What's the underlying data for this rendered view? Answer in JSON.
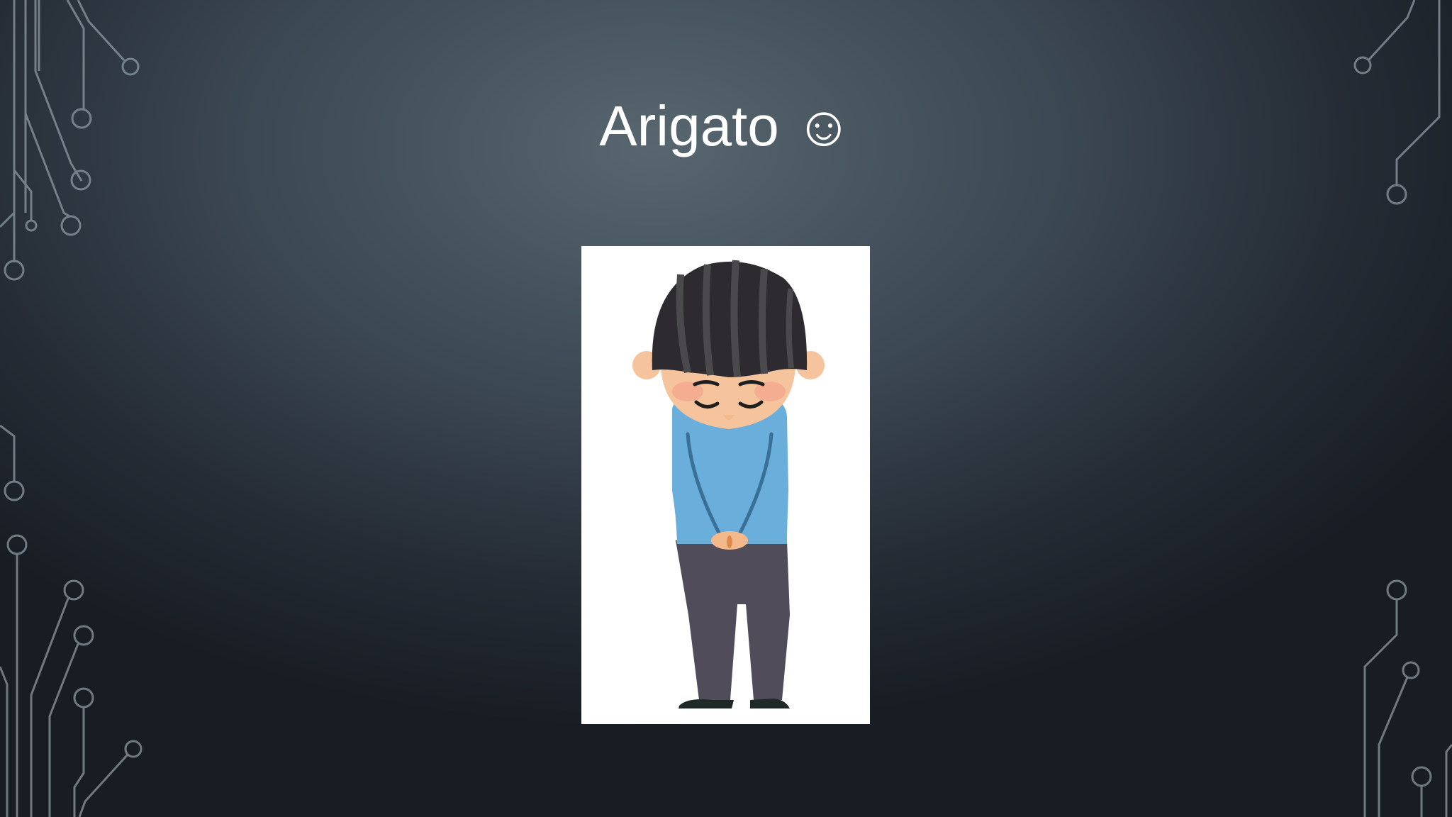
{
  "slide": {
    "title": "Arigato ☺"
  },
  "colors": {
    "background_center": "#57666f",
    "background_edge": "#181d24",
    "circuit_lines": "#8e9aa3",
    "title_text": "#ffffff",
    "shirt": "#6aaedb",
    "pants": "#514c5a",
    "hair": "#2d2b2f",
    "skin": "#f6c49c"
  },
  "illustration": {
    "subject": "bowing-man-illustration"
  }
}
